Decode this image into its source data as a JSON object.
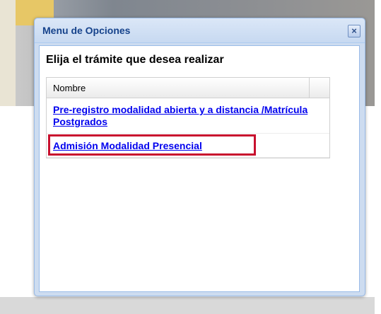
{
  "window": {
    "title": "Menu de Opciones",
    "close_glyph": "×"
  },
  "body": {
    "heading": "Elija el trámite que desea realizar"
  },
  "grid": {
    "column_header": "Nombre",
    "rows": [
      {
        "label": "Pre-registro modalidad abierta y a distancia /Matrícula Postgrados"
      },
      {
        "label": "Admisión Modalidad Presencial",
        "highlighted": true
      }
    ]
  },
  "colors": {
    "title": "#15428b",
    "link": "#0000ee",
    "highlight": "#c8102e",
    "window_border": "#99bbe8"
  },
  "icons": {
    "close": "close-icon"
  }
}
